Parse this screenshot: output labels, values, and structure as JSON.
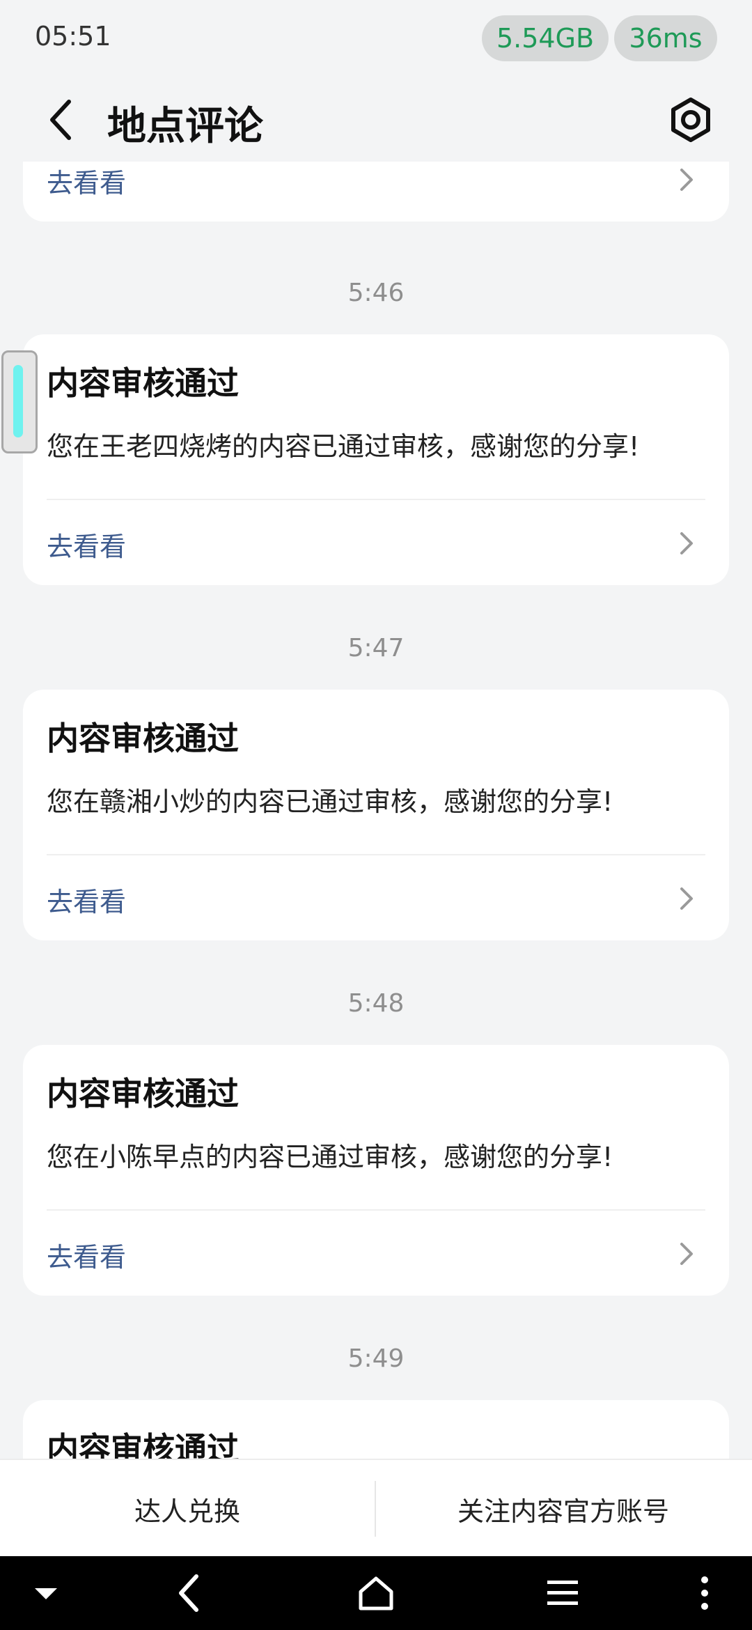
{
  "status_bar": {
    "time": "05:51",
    "memory": "5.54GB",
    "latency": "36ms"
  },
  "header": {
    "title": "地点评论"
  },
  "cards": [
    {
      "action_label": "去看看"
    },
    {
      "time": "5:46",
      "title": "内容审核通过",
      "body": "您在王老四烧烤的内容已通过审核，感谢您的分享!",
      "action_label": "去看看"
    },
    {
      "time": "5:47",
      "title": "内容审核通过",
      "body": "您在赣湘小炒的内容已通过审核，感谢您的分享!",
      "action_label": "去看看"
    },
    {
      "time": "5:48",
      "title": "内容审核通过",
      "body": "您在小陈早点的内容已通过审核，感谢您的分享!",
      "action_label": "去看看"
    },
    {
      "time": "5:49",
      "title": "内容审核通过"
    }
  ],
  "bottom_bar": {
    "left_label": "达人兑换",
    "right_label": "关注内容官方账号"
  },
  "colors": {
    "accent_link": "#3e5b8e",
    "pill_text": "#1e9a57",
    "background": "#f3f4f5"
  }
}
